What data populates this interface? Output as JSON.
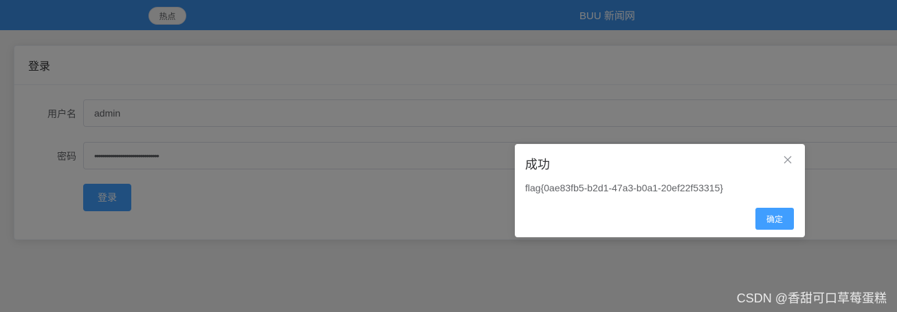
{
  "header": {
    "hot_label": "热点",
    "site_title": "BUU 新闻网"
  },
  "login_card": {
    "title": "登录",
    "username_label": "用户名",
    "username_value": "admin",
    "password_label": "密码",
    "password_value": "••••••••••••••••••••••••••••••••",
    "submit_label": "登录"
  },
  "dialog": {
    "title": "成功",
    "message": "flag{0ae83fb5-b2d1-47a3-b0a1-20ef22f53315}",
    "confirm_label": "确定",
    "close_icon": "close-icon"
  },
  "watermark": "CSDN @香甜可口草莓蛋糕",
  "colors": {
    "header_bg": "#3a8ee6",
    "primary": "#409eff"
  }
}
